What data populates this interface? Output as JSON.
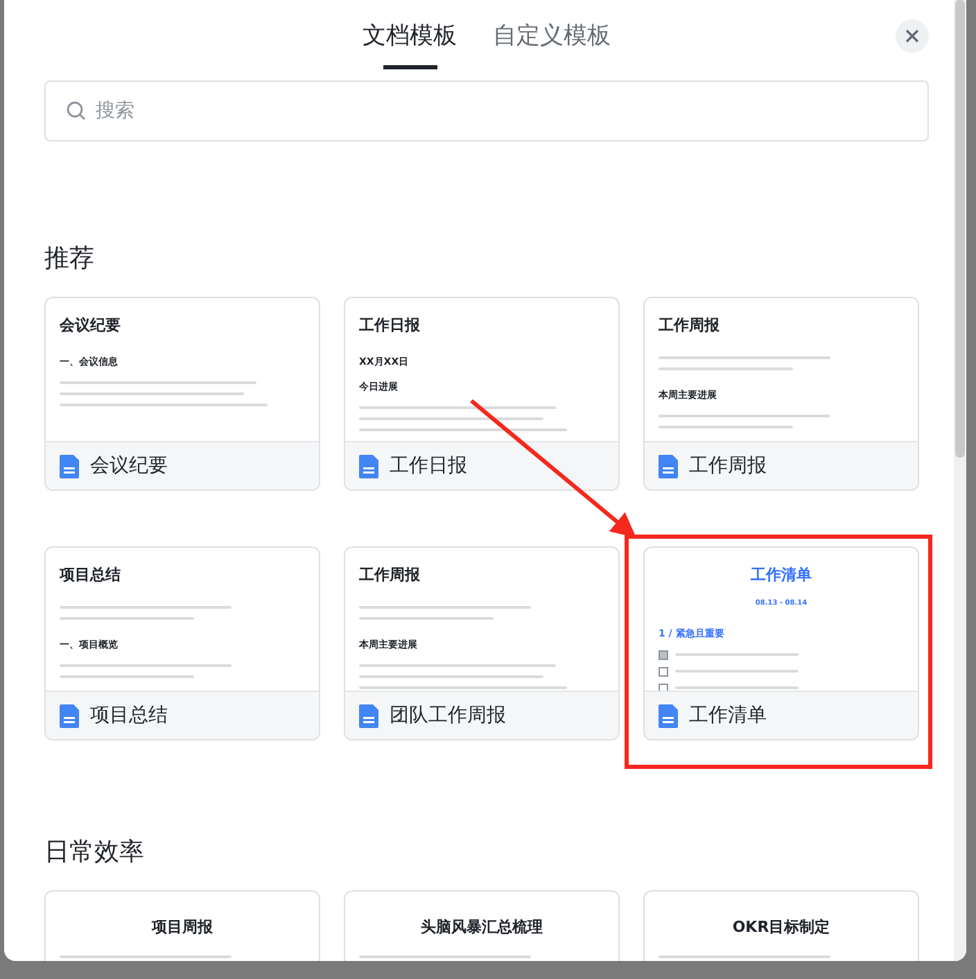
{
  "tabs": [
    {
      "label": "文档模板",
      "selected": true
    },
    {
      "label": "自定义模板",
      "selected": false
    }
  ],
  "search": {
    "placeholder": "搜索"
  },
  "sections": [
    {
      "title": "推荐",
      "templates": [
        {
          "name": "会议纪要",
          "preview": {
            "kind": "document",
            "title": "会议纪要",
            "blocks": [
              {
                "kind": "heading",
                "text": "一、会议信息"
              },
              {
                "kind": "bullets"
              }
            ]
          }
        },
        {
          "name": "工作日报",
          "preview": {
            "kind": "document",
            "title": "工作日报",
            "blocks": [
              {
                "kind": "heading",
                "text": "XX月XX日"
              },
              {
                "kind": "heading",
                "text": "今日进展"
              },
              {
                "kind": "bullets"
              }
            ]
          }
        },
        {
          "name": "工作周报",
          "preview": {
            "kind": "document",
            "title": "工作周报",
            "blocks": [
              {
                "kind": "filler"
              },
              {
                "kind": "heading",
                "text": "本周主要进展"
              },
              {
                "kind": "filler"
              }
            ]
          }
        },
        {
          "name": "项目总结",
          "preview": {
            "kind": "document",
            "title": "项目总结",
            "blocks": [
              {
                "kind": "filler"
              },
              {
                "kind": "heading",
                "text": "一、项目概览"
              },
              {
                "kind": "filler"
              }
            ]
          }
        },
        {
          "name": "团队工作周报",
          "preview": {
            "kind": "document",
            "title": "工作周报",
            "blocks": [
              {
                "kind": "filler"
              },
              {
                "kind": "heading",
                "text": "本周主要进展"
              },
              {
                "kind": "bullets"
              }
            ]
          }
        },
        {
          "name": "工作清单",
          "preview": {
            "kind": "checklist",
            "title": "工作清单",
            "blocks": [
              {
                "kind": "date",
                "text": "08.13 - 08.14"
              },
              {
                "kind": "accent-heading",
                "text": "1 / 紧急且重要"
              },
              {
                "kind": "check",
                "checked": true
              },
              {
                "kind": "check",
                "checked": false
              },
              {
                "kind": "check",
                "checked": false
              }
            ]
          }
        }
      ]
    },
    {
      "title": "日常效率",
      "templates": [
        {
          "preview": {
            "kind": "centered",
            "title": "项目周报",
            "blocks": [
              {
                "kind": "filler"
              }
            ]
          }
        },
        {
          "preview": {
            "kind": "centered",
            "title": "头脑风暴汇总梳理",
            "blocks": [
              {
                "kind": "filler"
              }
            ]
          }
        },
        {
          "preview": {
            "kind": "centered",
            "title": "OKR目标制定",
            "blocks": [
              {
                "kind": "filler"
              }
            ]
          }
        }
      ]
    }
  ],
  "annotation": {
    "kind": "arrow-and-frame"
  }
}
